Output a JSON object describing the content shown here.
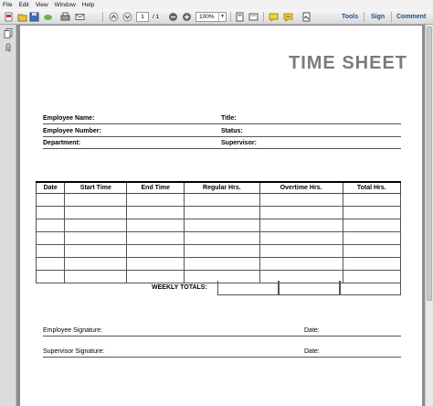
{
  "menu": [
    "File",
    "Edit",
    "View",
    "Window",
    "Help"
  ],
  "toolbar": {
    "page_current": "1",
    "page_total": "/ 1",
    "zoom": "100%",
    "tools_label": "Tools",
    "sign_label": "Sign",
    "comment_label": "Comment"
  },
  "doc": {
    "title": "TIME SHEET",
    "fields": {
      "employee_name": "Employee Name:",
      "title": "Title:",
      "employee_number": "Employee Number:",
      "status": "Status:",
      "department": "Department:",
      "supervisor": "Supervisor:"
    },
    "table": {
      "headers": [
        "Date",
        "Start Time",
        "End Time",
        "Regular Hrs.",
        "Overtime Hrs.",
        "Total Hrs."
      ],
      "row_count": 7
    },
    "weekly_totals": "WEEKLY TOTALS:",
    "employee_signature": "Employee Signature:",
    "supervisor_signature": "Supervisor Signature:",
    "date_label": "Date:"
  },
  "colors": {
    "title_gray": "#7b7b7b",
    "tool_blue": "#1a4f8b"
  }
}
